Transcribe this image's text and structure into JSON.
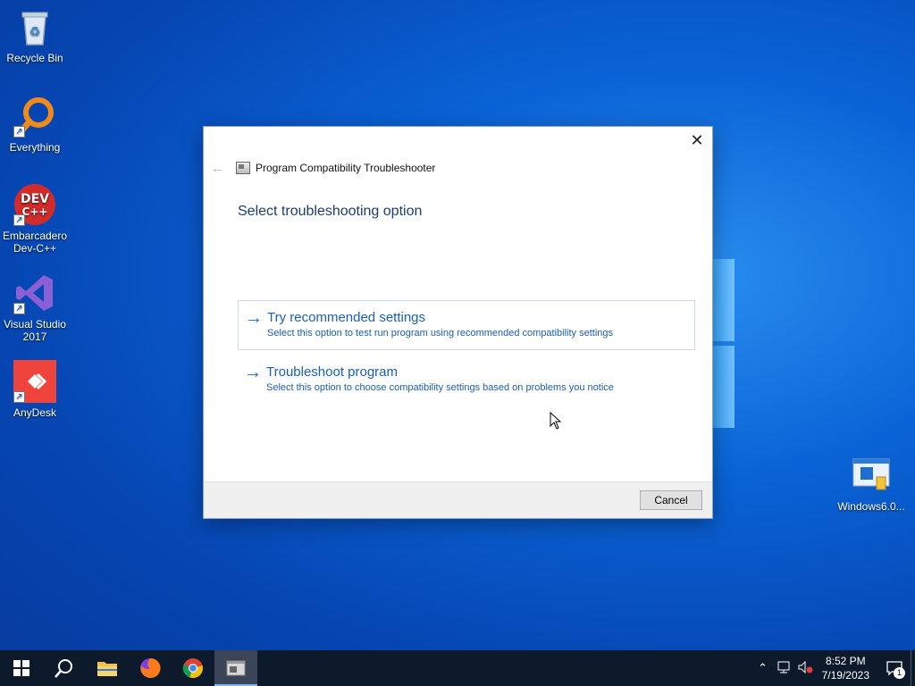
{
  "desktop": {
    "icons": [
      {
        "label": "Recycle Bin"
      },
      {
        "label": "Everything"
      },
      {
        "label": "Embarcadero Dev-C++"
      },
      {
        "label": "Visual Studio 2017"
      },
      {
        "label": "AnyDesk"
      },
      {
        "label": "Windows6.0..."
      }
    ],
    "devcpp_logo_text": "DEV C++"
  },
  "dialog": {
    "title": "Program Compatibility Troubleshooter",
    "heading": "Select troubleshooting option",
    "options": [
      {
        "title": "Try recommended settings",
        "description": "Select this option to test run program using recommended compatibility settings"
      },
      {
        "title": "Troubleshoot program",
        "description": "Select this option to choose compatibility settings based on problems you notice"
      }
    ],
    "cancel_label": "Cancel",
    "close_glyph": "✕",
    "back_glyph": "←",
    "option_arrow_glyph": "→"
  },
  "taskbar": {
    "clock_time": "8:52 PM",
    "clock_date": "7/19/2023",
    "notification_count": "1"
  },
  "colors": {
    "accent_link": "#1a5fb4",
    "taskbar_bg": "#0d1a2b"
  }
}
